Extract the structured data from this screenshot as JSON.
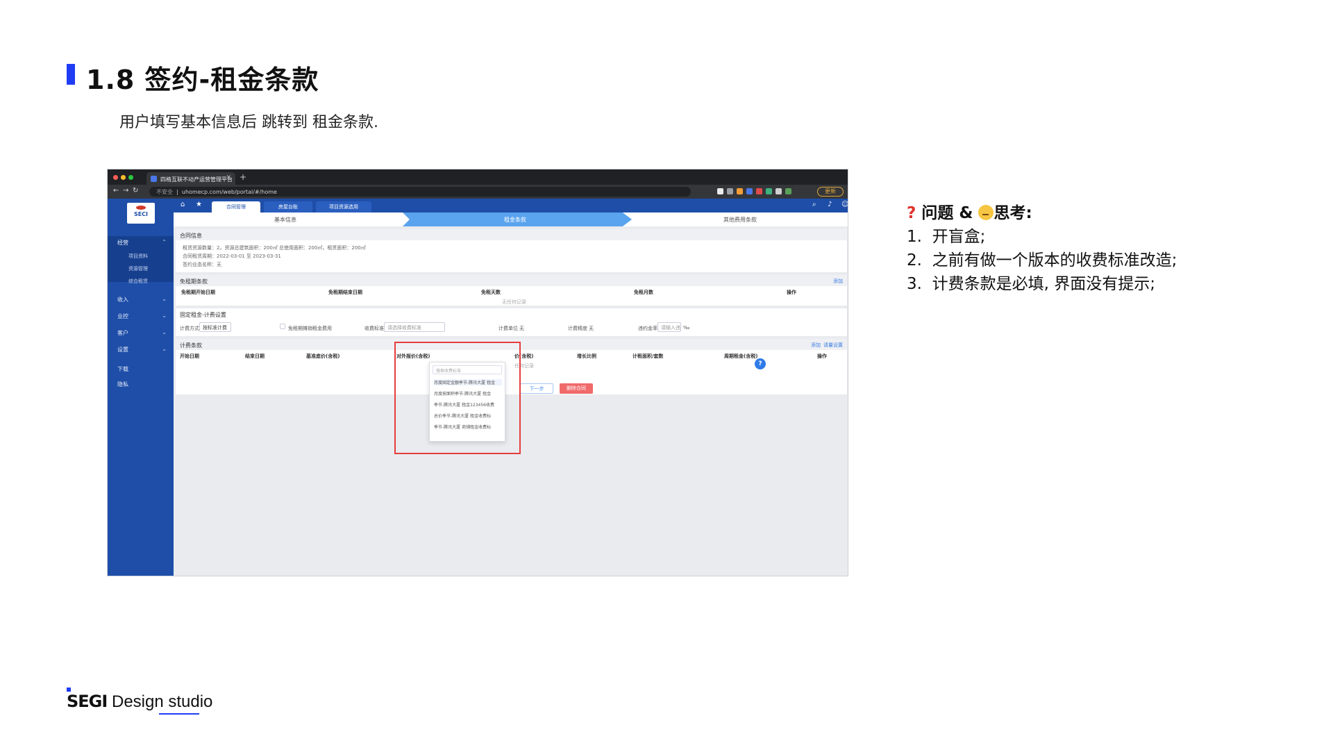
{
  "slide": {
    "title": "1.8 签约-租金条款",
    "subtitle": "用户填写基本信息后 跳转到 租金条款."
  },
  "notes": {
    "heading": "问题 & ",
    "heading2": "思考:",
    "items": [
      {
        "num": "1.",
        "text": "开盲盒;"
      },
      {
        "num": "2.",
        "text": "之前有做一个版本的收费标准改造;"
      },
      {
        "num": "3.",
        "text": "计费条款是必填, 界面没有提示;"
      }
    ]
  },
  "brand": {
    "strong": "SEGI",
    "rest": " Design studio"
  },
  "browser": {
    "tab_title": "四格互联不动产运营管理平台",
    "url_insecure": "不安全",
    "url": "uhomecp.com/web/portal/#/home",
    "update": "更新"
  },
  "sidebar": {
    "logo": "SECI",
    "items": [
      {
        "label": "经营"
      },
      {
        "label": "项目资料"
      },
      {
        "label": "资源管理"
      },
      {
        "label": "综合租赁"
      },
      {
        "label": "收入"
      },
      {
        "label": "业控"
      },
      {
        "label": "客户"
      },
      {
        "label": "设置"
      },
      {
        "label": "下载"
      },
      {
        "label": "隐私"
      }
    ]
  },
  "topnav": {
    "tabs": [
      "合同管理",
      "房屋台账",
      "项目资源选用"
    ]
  },
  "steps": [
    "基本信息",
    "租金条款",
    "其他费用条款"
  ],
  "contract_info": {
    "header": "合同信息",
    "line1": "租赁资源数量：2。资源总建筑面积：200㎡ 总使用面积：200㎡，租赁面积：200㎡",
    "line2": "合同租赁周期：2022-03-01  至  2023-03-31",
    "line3": "签约业态名称：无"
  },
  "free_rent": {
    "header": "免租期条款",
    "add": "添加",
    "columns": [
      "免租期开始日期",
      "免租期结束日期",
      "免租天数",
      "免租月数",
      "操作"
    ],
    "empty": "无任何记录"
  },
  "fixed_rent": {
    "header": "固定租金-计费设置",
    "method_label": "计费方式",
    "method_value": "按标准计费",
    "checkbox_label": "免租期摊销租金费用",
    "standard_label": "收费标准",
    "standard_placeholder": "请选择收费标准",
    "unit_label": "计费单位",
    "unit_value": "无",
    "precision_label": "计费精度",
    "precision_value": "无",
    "late_label": "违约金率",
    "late_placeholder": "请输入违",
    "late_unit": "‰"
  },
  "dropdown": {
    "search_placeholder": "搜索收费标准",
    "options": [
      "月度固定金额季节-腾讯大厦 租金",
      "月度按面积季节-腾讯大厦 租金",
      "季节-腾讯大厦 租金123456收费",
      "总价季节-腾讯大厦 租金收费标",
      "季节-腾讯大厦 商铺租金收费标"
    ]
  },
  "billing": {
    "header": "计费条款",
    "add": "添加",
    "batch": "请量设置",
    "columns": [
      "开始日期",
      "结束日期",
      "基准底价(含税)",
      "对外报价(含税)",
      "价(含税)",
      "增长比例",
      "计租面积/套数",
      "周期租金(含税)",
      "操作"
    ],
    "empty": "任何记录",
    "next": "下一步",
    "delete": "删除合同"
  },
  "help_icon": "?",
  "colors": {
    "accent": "#1f3cf5",
    "sidebar": "#1e4ea8",
    "step_active": "#5aa3ee",
    "highlight_box": "#e63c3c",
    "delete_button": "#f06a6a"
  }
}
